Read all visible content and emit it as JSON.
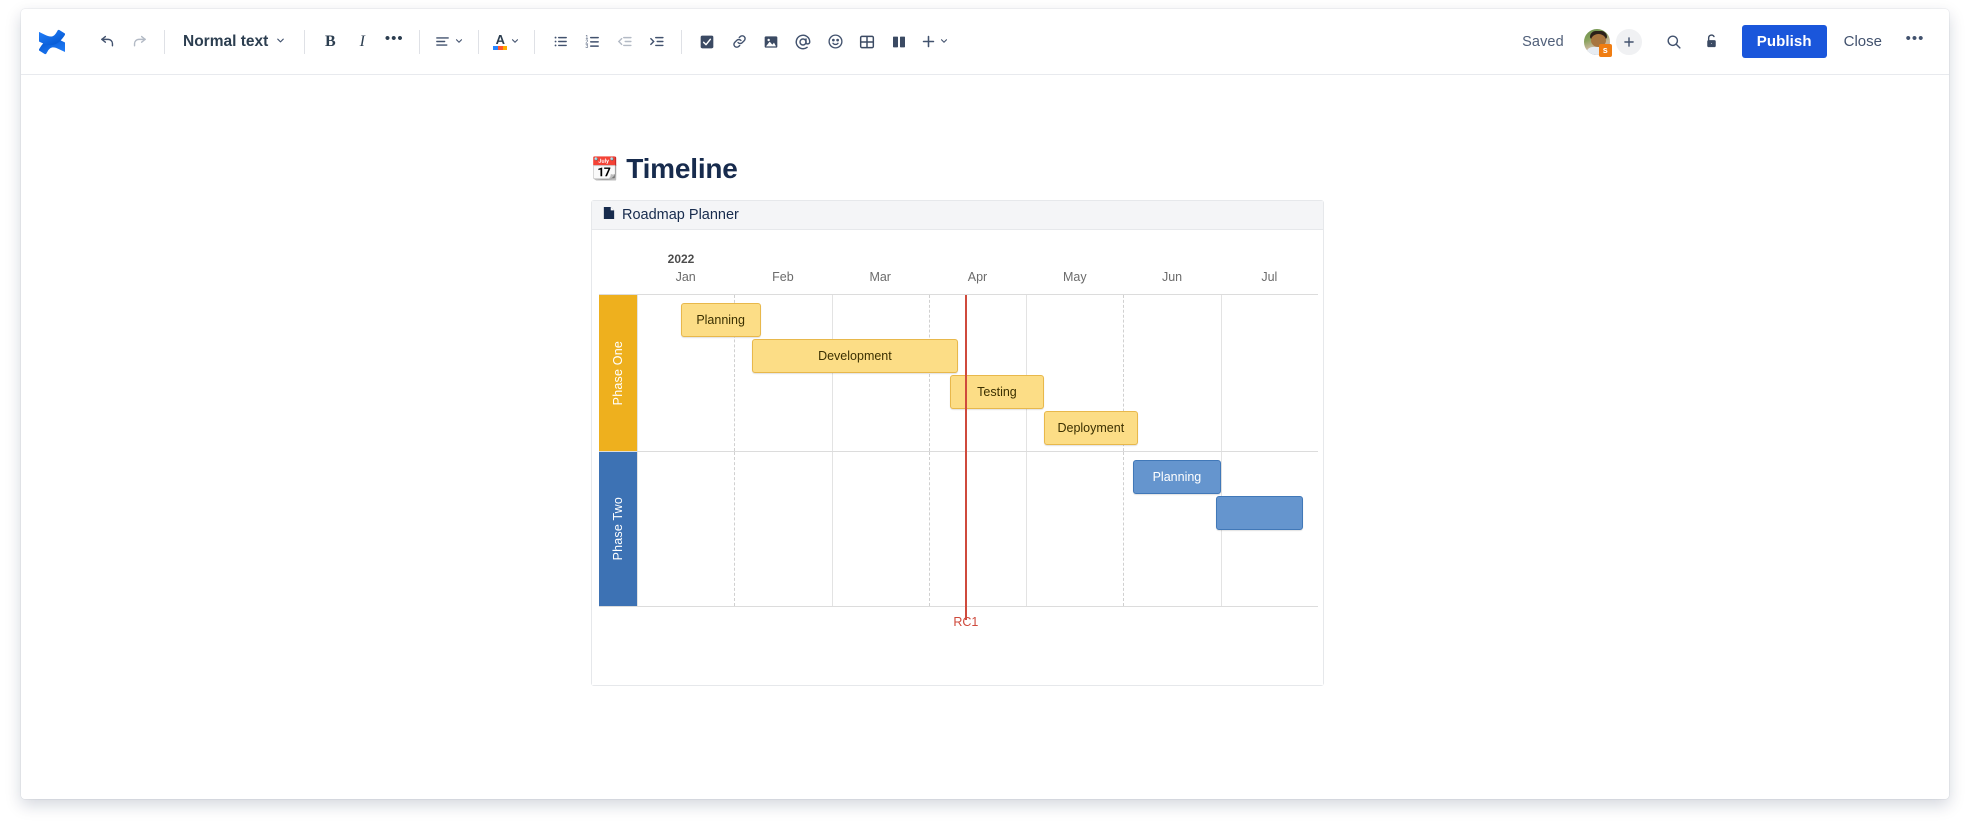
{
  "toolbar": {
    "logo_name": "confluence-logo",
    "undo_label": "Undo",
    "redo_label": "Redo",
    "text_style": "Normal text",
    "bold_label": "B",
    "italic_label": "I",
    "more_formatting_label": "•••",
    "align_label": "Text alignment",
    "text_color_label": "A",
    "bullet_list_label": "Bulleted list",
    "numbered_list_label": "Numbered list",
    "outdent_label": "Outdent",
    "indent_label": "Indent",
    "task_label": "Action item",
    "link_label": "Link",
    "image_label": "Image",
    "mention_label": "Mention",
    "emoji_label": "Emoji",
    "table_label": "Table",
    "layout_label": "Layouts",
    "insert_label": "Insert more content",
    "status_text": "Saved",
    "add_people_label": "+",
    "avatar_badge": "s",
    "search_label": "Search",
    "restrictions_label": "Restrictions",
    "publish_label": "Publish",
    "close_label": "Close",
    "more_label": "•••"
  },
  "document": {
    "title_emoji": "📆",
    "title": "Timeline"
  },
  "macro": {
    "icon_name": "page-icon",
    "title": "Roadmap Planner"
  },
  "chart_data": {
    "type": "bar",
    "subtype": "gantt-roadmap",
    "title": "Roadmap Planner",
    "year": "2022",
    "categories": [
      "Jan",
      "Feb",
      "Mar",
      "Apr",
      "May",
      "Jun",
      "Jul"
    ],
    "axis_label_row": "months",
    "grid": true,
    "lanes": [
      {
        "name": "Phase One",
        "color": "#eeb01e",
        "text_color": "#ffffff",
        "bars": [
          {
            "label": "Planning",
            "start_month": 0.45,
            "end_month": 1.27,
            "row": 0,
            "color": "#fcdd86",
            "border": "#e8b84b"
          },
          {
            "label": "Development",
            "start_month": 1.18,
            "end_month": 3.3,
            "row": 1,
            "color": "#fcdd86",
            "border": "#e8b84b"
          },
          {
            "label": "Testing",
            "start_month": 3.22,
            "end_month": 4.18,
            "row": 2,
            "color": "#fcdd86",
            "border": "#e8b84b"
          },
          {
            "label": "Deployment",
            "start_month": 4.18,
            "end_month": 5.15,
            "row": 3,
            "color": "#fcdd86",
            "border": "#e8b84b"
          }
        ]
      },
      {
        "name": "Phase Two",
        "color": "#3d72b4",
        "text_color": "#ffffff",
        "bars": [
          {
            "label": "Planning",
            "start_month": 5.1,
            "end_month": 6.0,
            "row": 0,
            "color": "#6595ce",
            "border": "#4178b8"
          },
          {
            "label": "",
            "start_month": 5.95,
            "end_month": 6.85,
            "row": 1,
            "color": "#6595ce",
            "border": "#4178b8"
          }
        ]
      }
    ],
    "milestones": [
      {
        "label": "RC1",
        "month": 3.37,
        "color": "#cf4a3c"
      }
    ],
    "colors": {
      "lane_phase_one": "#eeb01e",
      "lane_phase_two": "#3d72b4",
      "bar_amber": "#fcdd86",
      "bar_blue": "#6595ce",
      "milestone": "#cf4a3c",
      "grid_line": "#e3e3e3",
      "accent": "#1a56db"
    }
  }
}
